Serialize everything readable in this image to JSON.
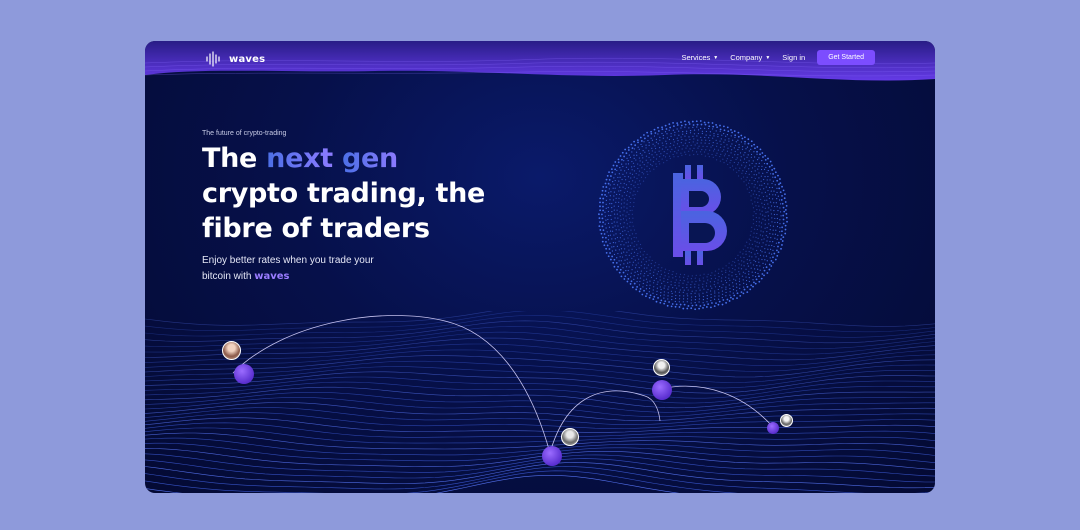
{
  "nav": {
    "brand": "waves",
    "links": [
      {
        "label": "Services",
        "has_caret": true
      },
      {
        "label": "Company",
        "has_caret": true
      },
      {
        "label": "Sign in",
        "has_caret": false
      }
    ],
    "cta": "Get Started"
  },
  "hero": {
    "eyebrow": "The future of crypto-trading",
    "headline_the": "The",
    "headline_next": "next",
    "headline_gen": "gen",
    "headline_line2": "crypto trading, the",
    "headline_line3": "fibre of traders",
    "subtitle_line1": "Enjoy better rates when you trade your",
    "subtitle_line2_prefix": "bitcoin with",
    "subtitle_brand": "waves"
  },
  "icons": {
    "logo": "sound-wave-logo-icon",
    "globe": "bitcoin-globe-icon",
    "caret": "chevron-down-icon"
  },
  "colors": {
    "accent": "#7c4dff",
    "background": "#8e9adb",
    "frame": "#06104a"
  }
}
